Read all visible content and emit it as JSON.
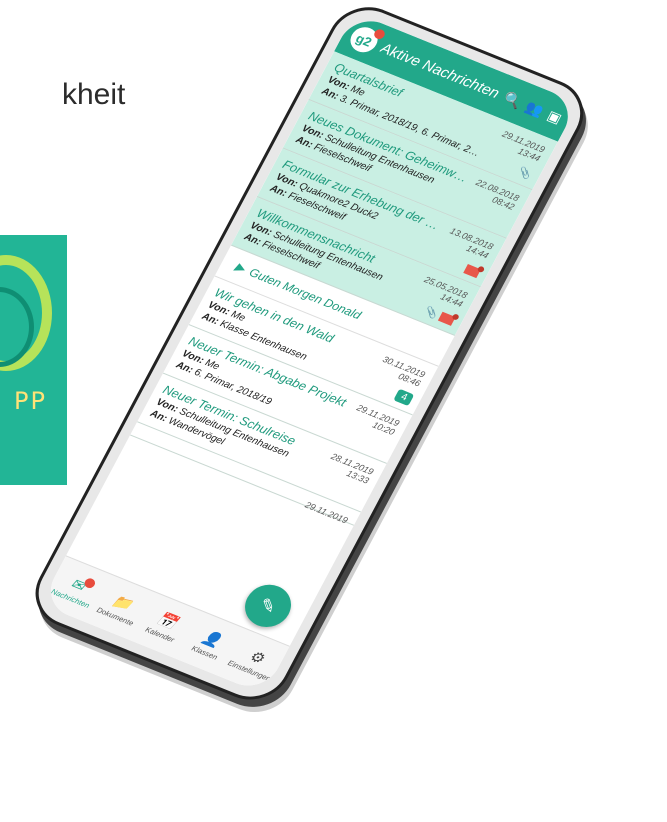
{
  "background": {
    "text_fragment": "kheit",
    "promo_text": "PP"
  },
  "app": {
    "title": "Aktive Nachrichten",
    "logo_text": "g2",
    "accent": "#22a88a"
  },
  "messages": [
    {
      "subject": "Quartalsbrief",
      "from_label": "Von:",
      "from": "Me",
      "to_label": "An:",
      "to": "3. Primar, 2018/19, 6. Primar, 2018/...",
      "date": "29.11.2019",
      "time": "13:44",
      "unread": true,
      "attachment": true
    },
    {
      "subject": "Neues Dokument: Geheimwissen d...",
      "from_label": "Von:",
      "from": "Schulleitung Entenhausen",
      "to_label": "An:",
      "to": "Fieselschweif",
      "date": "22.08.2018",
      "time": "08:42",
      "unread": true
    },
    {
      "subject": "Formular zur Erhebung der Kontakt...",
      "from_label": "Von:",
      "from": "Quakmore2 Duck2",
      "to_label": "An:",
      "to": "Fieselschweif",
      "date": "13.08.2018",
      "time": "14:44",
      "unread": true,
      "form": true
    },
    {
      "subject": "Willkommensnachricht",
      "from_label": "Von:",
      "from": "Schulleitung Entenhausen",
      "to_label": "An:",
      "to": "Fieselschweif",
      "date": "25.05.2018",
      "time": "14:44",
      "unread": true,
      "attachment": true
    }
  ],
  "group_header": "Guten Morgen Donald",
  "messages_read": [
    {
      "subject": "Wir gehen in den Wald",
      "from_label": "Von:",
      "from": "Me",
      "to_label": "An:",
      "to": "Klasse Entenhausen",
      "date": "30.11.2019",
      "time": "08:46",
      "count": "4"
    },
    {
      "subject": "Neuer Termin: Abgabe Projekt",
      "from_label": "Von:",
      "from": "Me",
      "to_label": "An:",
      "to": "6. Primar, 2018/19",
      "date": "29.11.2019",
      "time": "10:20"
    },
    {
      "subject": "Neuer Termin: Schulreise",
      "from_label": "Von:",
      "from": "Schulleitung Entenhausen",
      "to_label": "An:",
      "to": "Wandervögel",
      "date": "28.11.2019",
      "time": "13:33"
    },
    {
      "subject": "",
      "from_label": "",
      "from": "",
      "to_label": "",
      "to": "",
      "date": "29.11.2019",
      "time": ""
    }
  ],
  "nav": [
    {
      "label": "Nachrichten",
      "icon": "mail-icon"
    },
    {
      "label": "Dokumente",
      "icon": "folder-icon"
    },
    {
      "label": "Kalender",
      "icon": "calendar-icon"
    },
    {
      "label": "Klassen",
      "icon": "person-icon"
    },
    {
      "label": "Einstellungen",
      "icon": "gear-icon"
    }
  ]
}
